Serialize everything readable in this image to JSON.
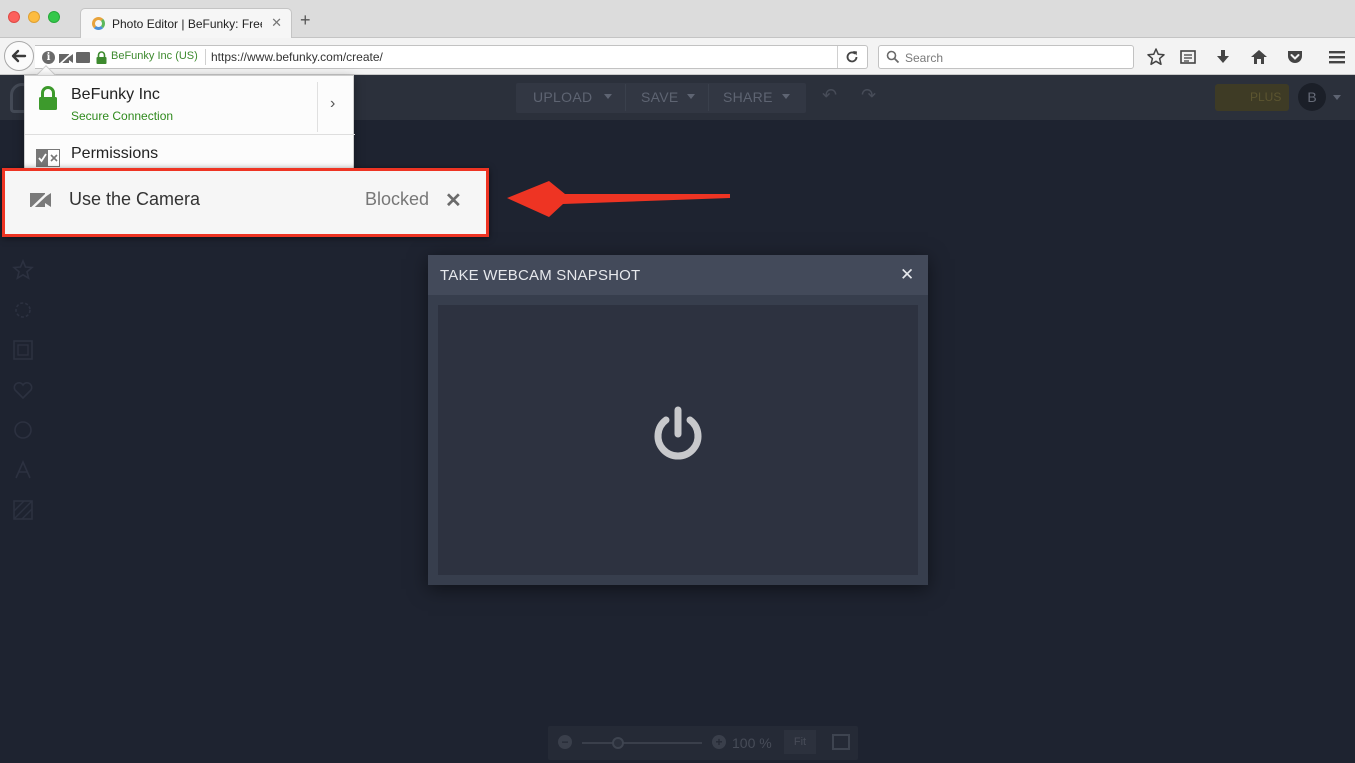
{
  "browser": {
    "tab_title": "Photo Editor | BeFunky: Free Online Photo Editing",
    "tab_close": "✕",
    "new_tab": "+",
    "identity_label": "BeFunky Inc (US)",
    "url": "https://www.befunky.com/create/",
    "search_placeholder": "Search"
  },
  "app": {
    "menu": [
      {
        "label": "UPLOAD"
      },
      {
        "label": "SAVE"
      },
      {
        "label": "SHARE"
      }
    ],
    "plus_label": "PLUS",
    "avatar_initial": "B"
  },
  "identity_popup": {
    "title": "BeFunky Inc",
    "subtitle": "Secure Connection",
    "permissions_label": "Permissions",
    "camera_permission": {
      "label": "Use the Camera",
      "state": "Blocked",
      "remove": "✕"
    }
  },
  "annotation": {
    "highlight_color": "#ee3423",
    "arrow_color": "#ee3423"
  },
  "webcam_dialog": {
    "title": "TAKE WEBCAM SNAPSHOT",
    "close": "✕",
    "icon": "power-icon"
  },
  "zoom": {
    "level_label": "100 %",
    "fit_label": "Fit",
    "slider_level": 0.3
  },
  "colors": {
    "page_bg": "#1e2330",
    "secure_green": "#2f8a1d",
    "dialog_bg": "#373e4d"
  }
}
